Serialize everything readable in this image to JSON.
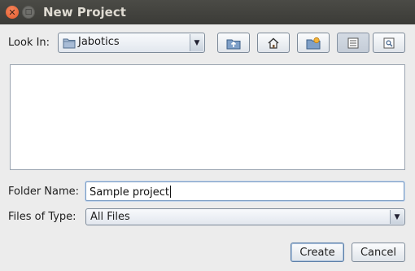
{
  "window": {
    "title": "New Project"
  },
  "look_in": {
    "label": "Look In:",
    "value": "Jabotics",
    "icon": "folder-icon"
  },
  "toolbar": {
    "buttons": [
      {
        "name": "up-one-level-button",
        "icon": "folder-up-icon"
      },
      {
        "name": "home-button",
        "icon": "home-icon"
      },
      {
        "name": "new-folder-button",
        "icon": "new-folder-icon"
      },
      {
        "name": "list-view-button",
        "icon": "list-view-icon",
        "active": true
      },
      {
        "name": "details-view-button",
        "icon": "details-view-icon"
      }
    ]
  },
  "file_list": {
    "items": []
  },
  "folder_name": {
    "label": "Folder Name:",
    "value": "Sample project"
  },
  "files_of_type": {
    "label": "Files of Type:",
    "value": "All Files"
  },
  "actions": {
    "create_label": "Create",
    "cancel_label": "Cancel"
  },
  "colors": {
    "titlebar": "#3e3e3a",
    "close_button": "#e9643a",
    "window_bg": "#ececec",
    "focus_border": "#7a9cc4"
  }
}
